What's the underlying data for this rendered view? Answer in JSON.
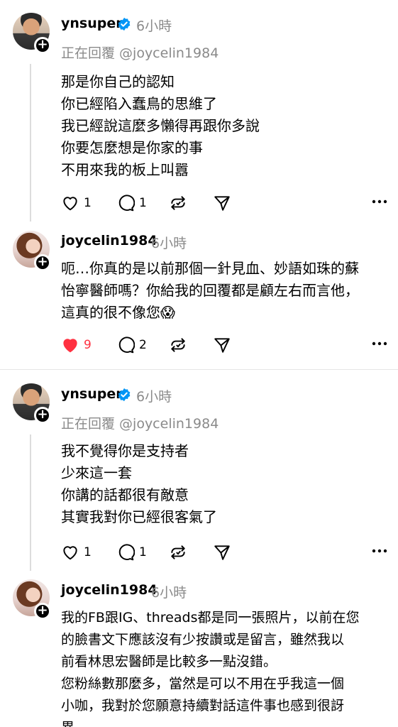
{
  "posts": [
    {
      "username": "ynsuper",
      "time": "6小時",
      "verified": true,
      "replying_to": "正在回覆 @joycelin1984",
      "lines": [
        "那是你自己的認知",
        "你已經陷入蠢鳥的思維了",
        "我已經說這麼多懶得再跟你多說",
        "你要怎麼想是你家的事",
        "不用來我的板上叫囂"
      ],
      "likes": "1",
      "replies": "1",
      "liked": false
    },
    {
      "username": "joycelin1984",
      "time": "6小時",
      "verified": false,
      "lines": [
        "呃…你真的是以前那個一針見血、妙語如珠的蘇",
        "怡寧醫師嗎？你給我的回覆都是顧左右而言他，",
        "這真的很不像您😱"
      ],
      "likes": "9",
      "replies": "2",
      "liked": true
    },
    {
      "username": "ynsuper",
      "time": "6小時",
      "verified": true,
      "replying_to": "正在回覆 @joycelin1984",
      "lines": [
        "我不覺得你是支持者",
        "少來這一套",
        "你講的話都很有敵意",
        "其實我對你已經很客氣了"
      ],
      "likes": "1",
      "replies": "1",
      "liked": false
    },
    {
      "username": "joycelin1984",
      "time": "6小時",
      "verified": false,
      "lines": [
        "我的FB跟IG、threads都是同一張照片，以前在您",
        "的臉書文下應該沒有少按讚或是留言，雖然我以",
        "前看林思宏醫師是比較多一點沒錯。",
        "您粉絲數那麼多，當然是可以不用在乎我這一個",
        "小咖，我對於您願意持續對話這件事也感到很訝",
        "異。"
      ]
    }
  ],
  "colors": {
    "liked": "#ff3040",
    "verified": "#0095f6",
    "muted": "#8a8a8a"
  },
  "icons": [
    "heart-icon",
    "comment-icon",
    "repost-icon",
    "share-icon",
    "more-icon",
    "verified-badge-icon",
    "follow-plus-icon"
  ]
}
